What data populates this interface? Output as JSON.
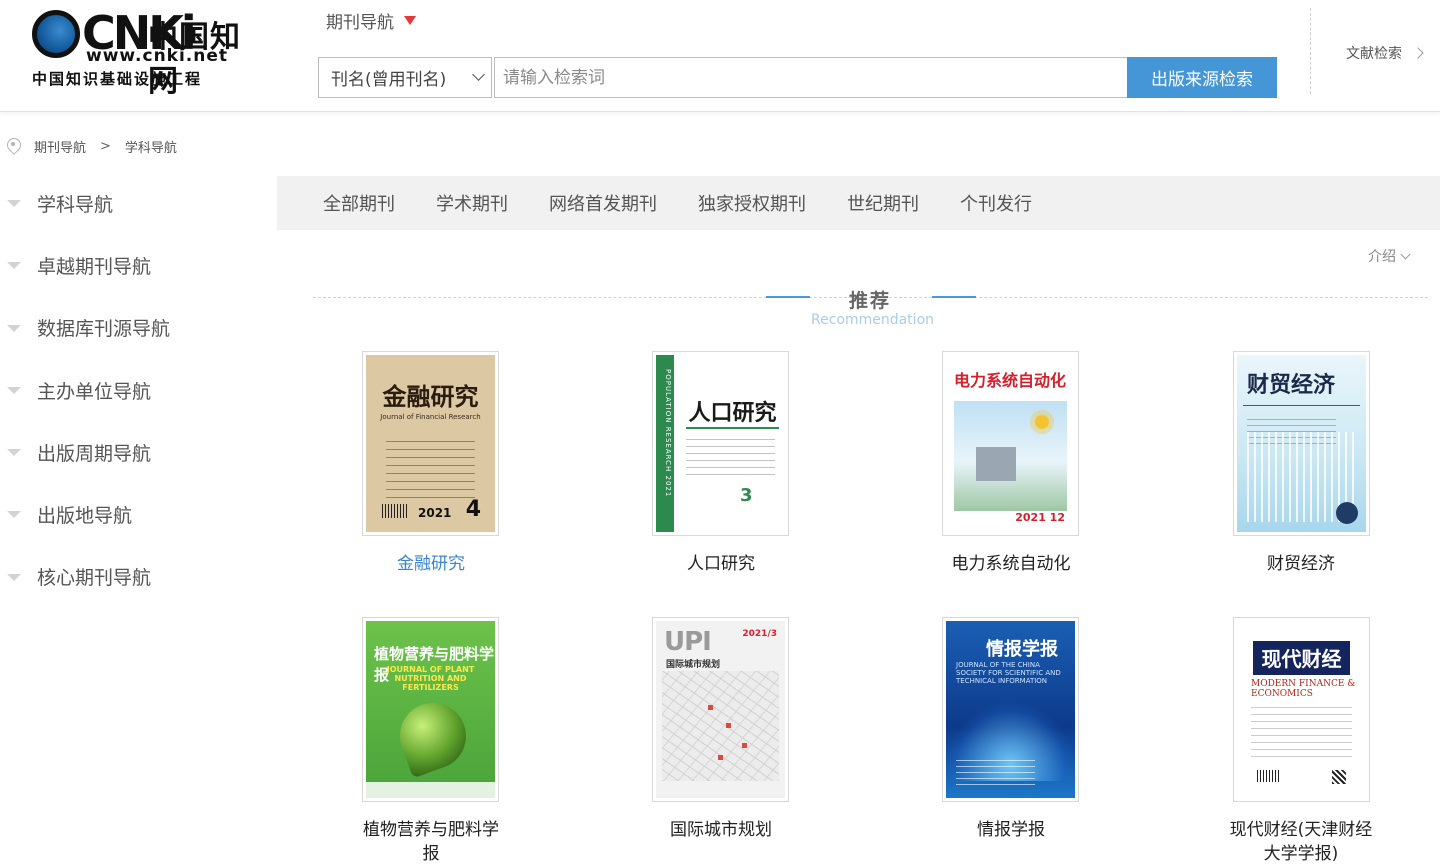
{
  "logo": {
    "mark": "CNKi",
    "script": "中国知网",
    "url": "www.cnki.net",
    "subtitle": "中国知识基础设施工程"
  },
  "header": {
    "nav_title": "期刊导航",
    "search_field": "刊名(曾用刊名)",
    "search_placeholder": "请输入检索词",
    "search_button": "出版来源检索",
    "literature_search": "文献检索"
  },
  "breadcrumb": [
    "期刊导航",
    ">",
    "学科导航"
  ],
  "sidebar": {
    "items": [
      "学科导航",
      "卓越期刊导航",
      "数据库刊源导航",
      "主办单位导航",
      "出版周期导航",
      "出版地导航",
      "核心期刊导航"
    ]
  },
  "tabs": [
    "全部期刊",
    "学术期刊",
    "网络首发期刊",
    "独家授权期刊",
    "世纪期刊",
    "个刊发行"
  ],
  "intro_label": "介绍",
  "recommend": {
    "title": "推荐",
    "subtitle": "Recommendation"
  },
  "journals": [
    {
      "name": "金融研究",
      "active": true,
      "cover": {
        "title": "金融研究",
        "english": "Journal of Financial Research",
        "year": "2021",
        "issue": "4"
      }
    },
    {
      "name": "人口研究",
      "active": false,
      "cover": {
        "title": "人口研究",
        "english": "POPULATION RESEARCH 2021",
        "issue": "3"
      }
    },
    {
      "name": "电力系统自动化",
      "active": false,
      "cover": {
        "title": "电力系统自动化",
        "year": "2021 12"
      }
    },
    {
      "name": "财贸经济",
      "active": false,
      "cover": {
        "title": "财贸经济"
      }
    },
    {
      "name": "植物营养与肥料学报",
      "active": false,
      "cover": {
        "title": "植物营养与肥料学报",
        "english": "JOURNAL OF PLANT NUTRITION AND FERTILIZERS"
      }
    },
    {
      "name": "国际城市规划",
      "active": false,
      "cover": {
        "title": "UPI",
        "subtitle": "国际城市规划",
        "year": "2021/3"
      }
    },
    {
      "name": "情报学报",
      "active": false,
      "cover": {
        "title": "情报学报",
        "english": "JOURNAL OF THE CHINA SOCIETY FOR SCIENTIFIC AND TECHNICAL INFORMATION"
      }
    },
    {
      "name": "现代财经(天津财经大学学报)",
      "active": false,
      "cover": {
        "title": "现代财经",
        "english": "MODERN FINANCE & ECONOMICS"
      }
    }
  ],
  "colors": {
    "accent_blue": "#4596d6",
    "link_blue": "#3a86c8",
    "caret_red": "#e4393c",
    "tabbar_bg": "#f1f1f1"
  },
  "icons": {
    "nav_caret": "caret-down-icon",
    "search_select": "chevron-down-icon",
    "literature_search": "chevron-right-icon",
    "breadcrumb": "location-pin-icon",
    "sidebar_item": "triangle-down-icon",
    "intro": "chevron-down-icon"
  }
}
